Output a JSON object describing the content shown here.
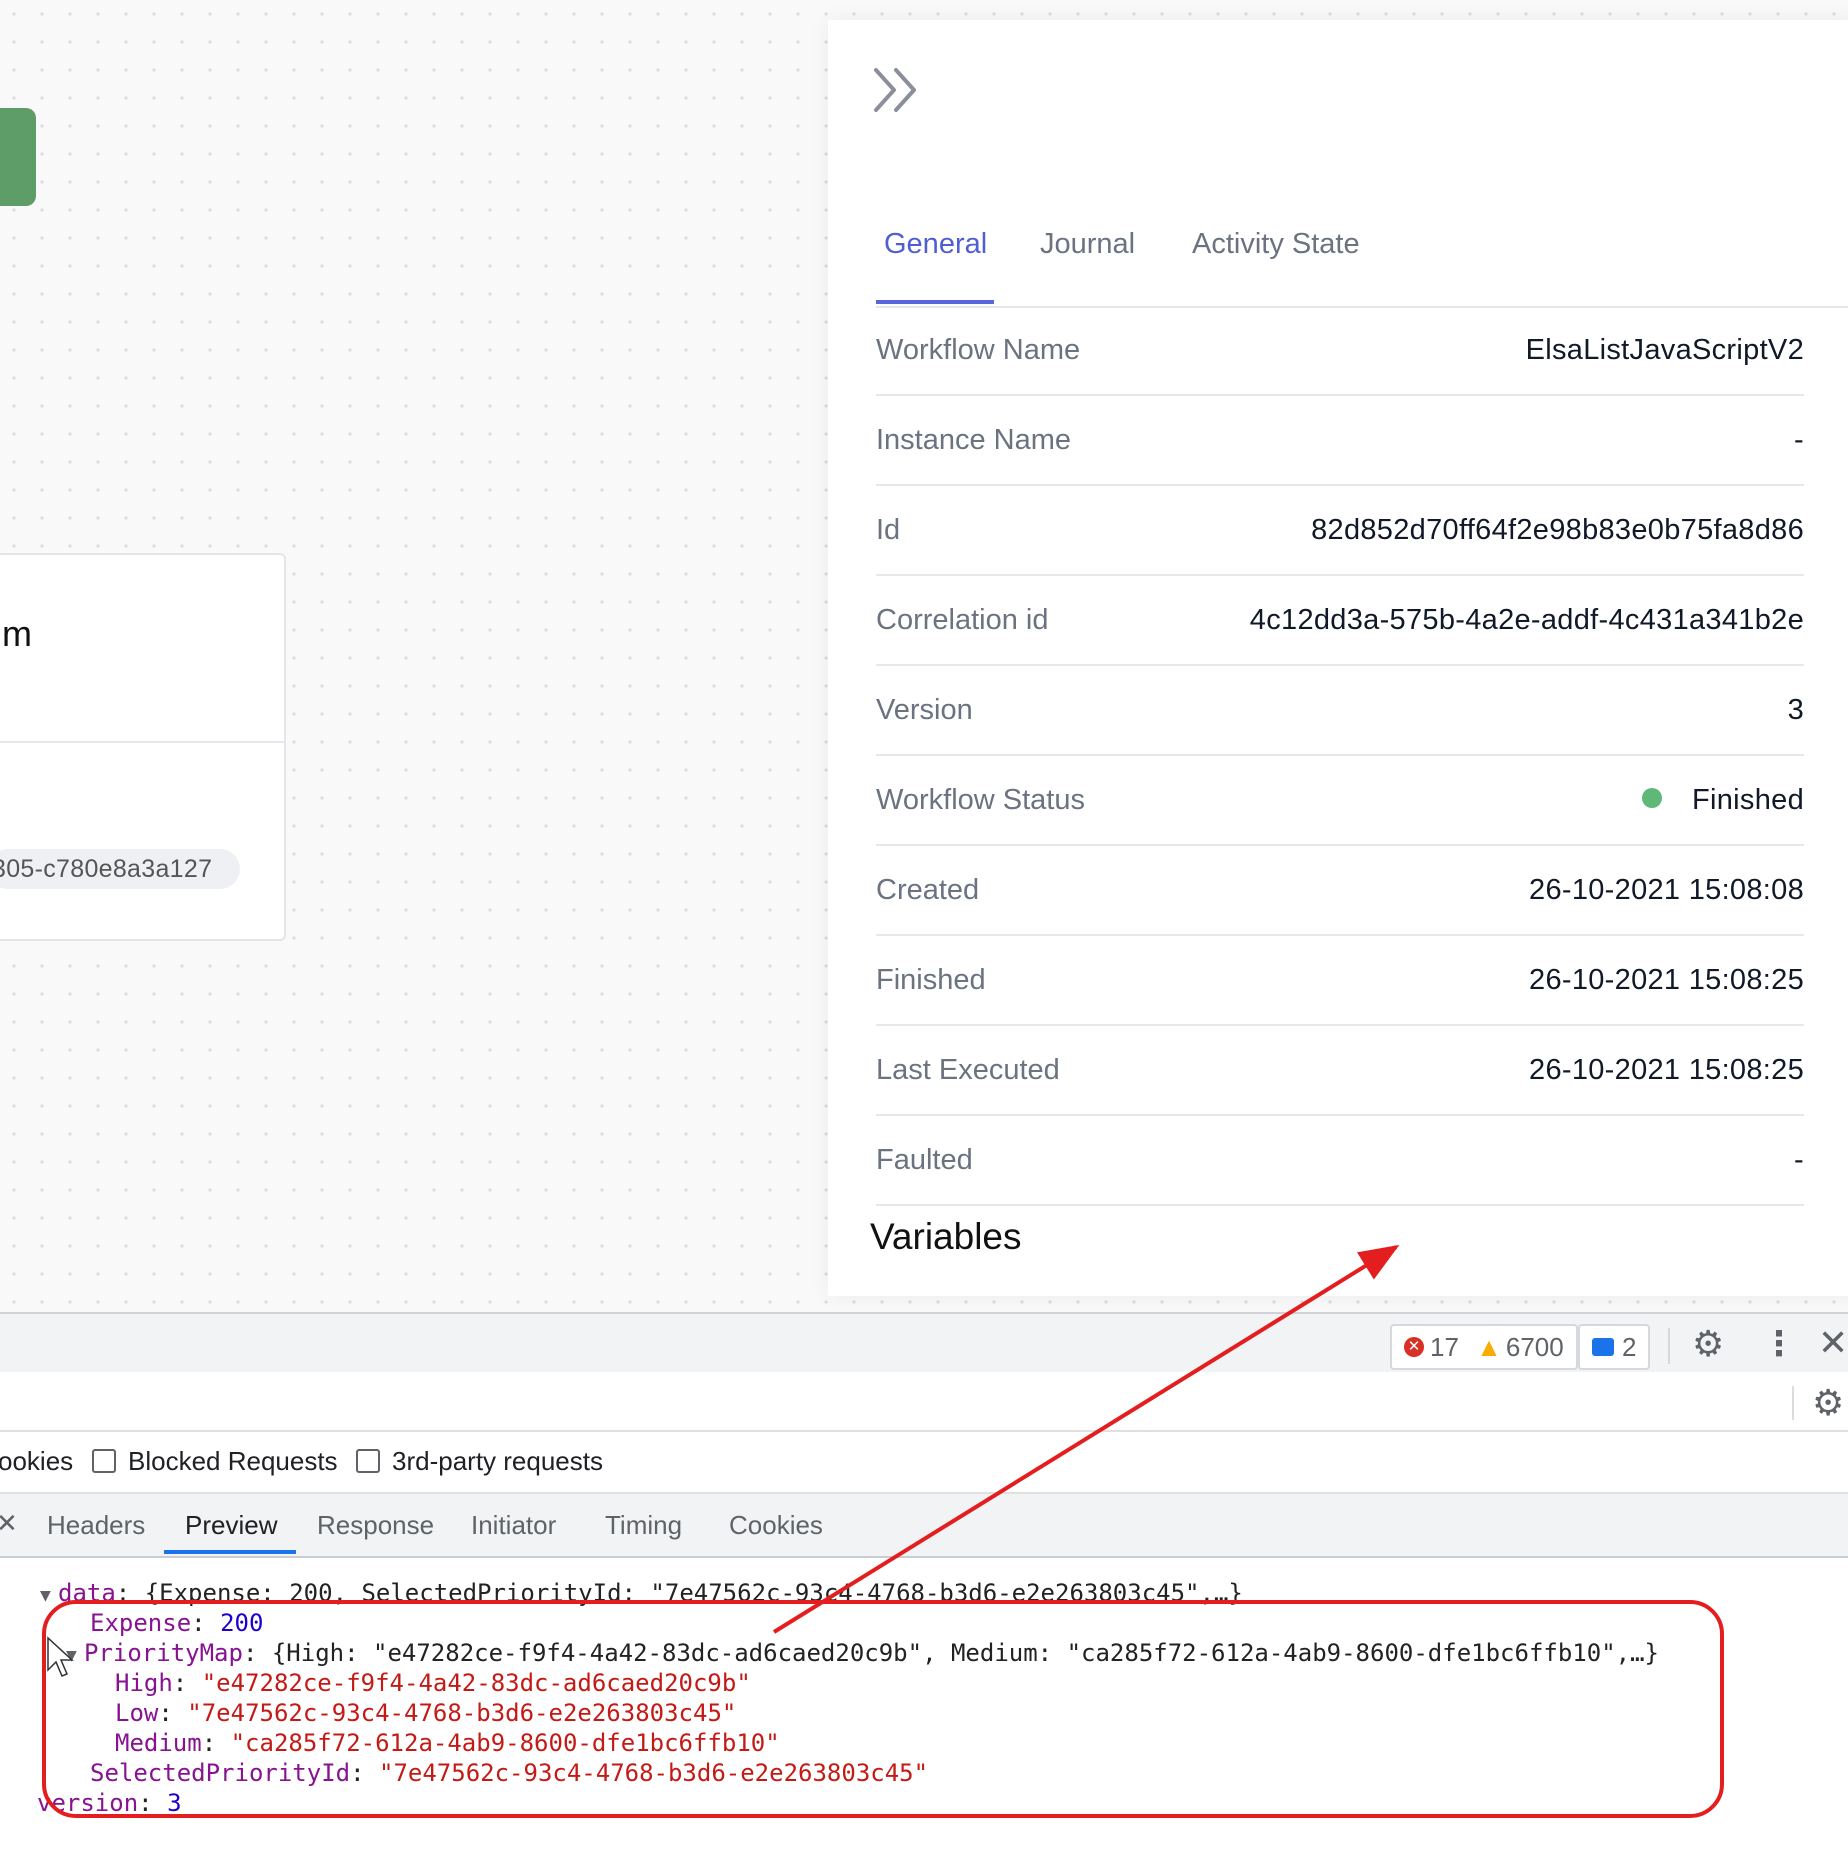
{
  "canvas": {
    "activity_title": "m",
    "activity_id": "305-c780e8a3a127"
  },
  "panel": {
    "tabs": [
      "General",
      "Journal",
      "Activity State"
    ],
    "rows": [
      {
        "label": "Workflow Name",
        "value": "ElsaListJavaScriptV2"
      },
      {
        "label": "Instance Name",
        "value": "-"
      },
      {
        "label": "Id",
        "value": "82d852d70ff64f2e98b83e0b75fa8d86"
      },
      {
        "label": "Correlation id",
        "value": "4c12dd3a-575b-4a2e-addf-4c431a341b2e"
      },
      {
        "label": "Version",
        "value": "3"
      },
      {
        "label": "Workflow Status",
        "value": "Finished",
        "status_color": "#5fb878"
      },
      {
        "label": "Created",
        "value": "26-10-2021 15:08:08"
      },
      {
        "label": "Finished",
        "value": "26-10-2021 15:08:25"
      },
      {
        "label": "Last Executed",
        "value": "26-10-2021 15:08:25"
      },
      {
        "label": "Faulted",
        "value": "-"
      }
    ],
    "variables_title": "Variables"
  },
  "devtools": {
    "errors": "17",
    "warnings": "6700",
    "issues": "2",
    "filters": {
      "cookies_fragment": "ookies",
      "blocked_requests": "Blocked Requests",
      "third_party": "3rd-party requests"
    },
    "subtabs": [
      "Headers",
      "Preview",
      "Response",
      "Initiator",
      "Timing",
      "Cookies"
    ],
    "active_subtab": "Preview",
    "preview": {
      "data_key": "data",
      "data_summary": "{Expense: 200, SelectedPriorityId: \"7e47562c-93c4-4768-b3d6-e2e263803c45\",…}",
      "expense_key": "Expense",
      "expense_value": "200",
      "prioritymap_key": "PriorityMap",
      "prioritymap_summary": "{High: \"e47282ce-f9f4-4a42-83dc-ad6caed20c9b\", Medium: \"ca285f72-612a-4ab9-8600-dfe1bc6ffb10\",…}",
      "high_key": "High",
      "high_value": "\"e47282ce-f9f4-4a42-83dc-ad6caed20c9b\"",
      "low_key": "Low",
      "low_value": "\"7e47562c-93c4-4768-b3d6-e2e263803c45\"",
      "medium_key": "Medium",
      "medium_value": "\"ca285f72-612a-4ab9-8600-dfe1bc6ffb10\"",
      "selected_key": "SelectedPriorityId",
      "selected_value": "\"7e47562c-93c4-4768-b3d6-e2e263803c45\"",
      "version_key": "version",
      "version_value": "3"
    }
  },
  "annotation_color": "#e41e1e"
}
